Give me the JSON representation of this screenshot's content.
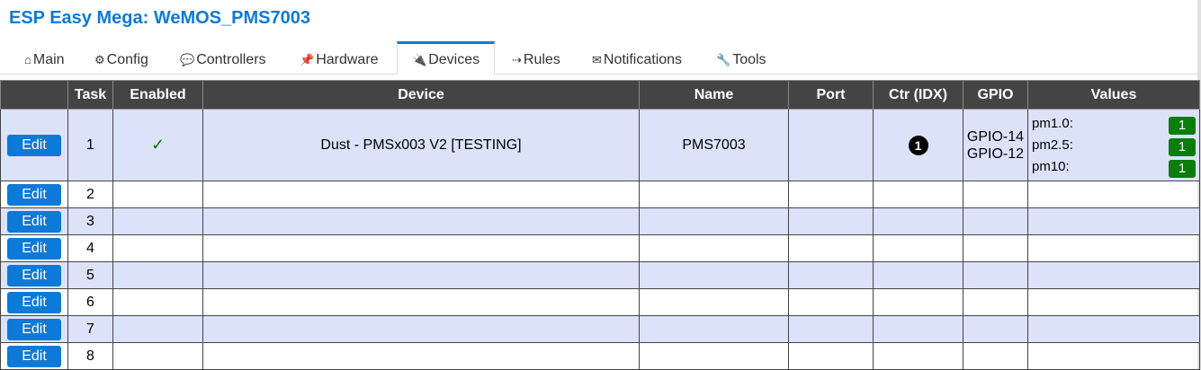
{
  "title": "ESP Easy Mega: WeMOS_PMS7003",
  "tabs": [
    {
      "icon": "⌂",
      "label": "Main"
    },
    {
      "icon": "⚙",
      "label": "Config"
    },
    {
      "icon": "💬",
      "label": "Controllers"
    },
    {
      "icon": "📌",
      "label": "Hardware"
    },
    {
      "icon": "🔌",
      "label": "Devices"
    },
    {
      "icon": "⇢",
      "label": "Rules"
    },
    {
      "icon": "✉",
      "label": "Notifications"
    },
    {
      "icon": "🔧",
      "label": "Tools"
    }
  ],
  "active_tab": "Devices",
  "accent_color": "#0e7ad8",
  "table": {
    "headers": [
      "",
      "Task",
      "Enabled",
      "Device",
      "Name",
      "Port",
      "Ctr (IDX)",
      "GPIO",
      "Values"
    ],
    "edit_label": "Edit",
    "rows": [
      {
        "task": "1",
        "enabled": "✓",
        "device": "Dust - PMSx003 V2 [TESTING]",
        "name": "PMS7003",
        "port": "",
        "ctr": "1",
        "gpio": [
          "GPIO-14",
          "GPIO-12"
        ],
        "values": [
          {
            "name": "pm1.0:",
            "value": "1"
          },
          {
            "name": "pm2.5:",
            "value": "1"
          },
          {
            "name": "pm10:",
            "value": "1"
          }
        ]
      },
      {
        "task": "2"
      },
      {
        "task": "3"
      },
      {
        "task": "4"
      },
      {
        "task": "5"
      },
      {
        "task": "6"
      },
      {
        "task": "7"
      },
      {
        "task": "8"
      }
    ]
  }
}
